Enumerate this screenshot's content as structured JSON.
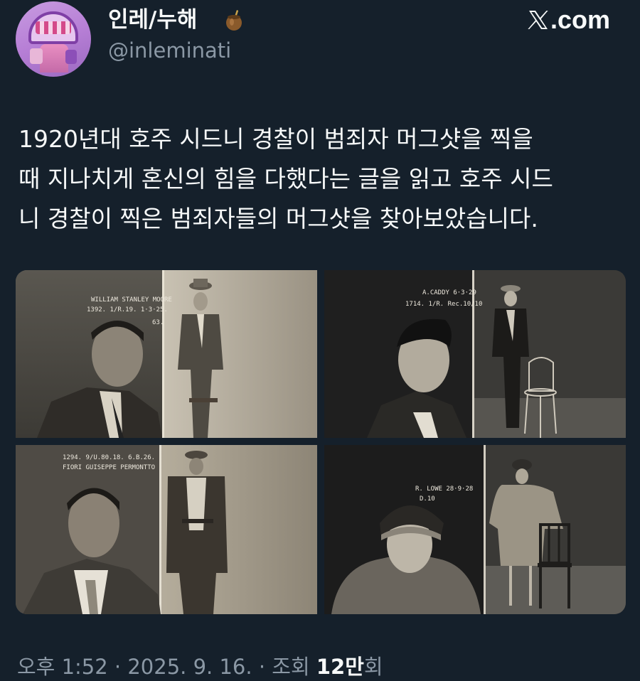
{
  "author": {
    "display_name": "인레/누해",
    "handle": "@inleminati",
    "name_emoji": "mate-cup-icon"
  },
  "brand": {
    "label": ".com",
    "icon": "x-logo-icon"
  },
  "tweet": {
    "lines": [
      "1920년대 호주 시드니 경찰이 범죄자 머그샷을 찍을",
      "때 지나치게 혼신의 힘을 다했다는 글을 읽고 호주 시드",
      "니 경찰이 찍은 범죄자들의 머그샷을 찾아보았습니다."
    ]
  },
  "media": {
    "photos": [
      {
        "caption_line1": "WILLIAM STANLEY MOORE",
        "caption_line2": "1392. 1/R.19. 1·3·25.",
        "tag": "63."
      },
      {
        "caption_line1": "A.CADDY 6·3·29",
        "caption_line2": "1714. 1/R. Rec.10/10"
      },
      {
        "caption_line1": "1294. 9/U.80.18. 6.B.26.",
        "caption_line2": "FIORI GUISEPPE PERMONTTO"
      },
      {
        "caption_line1": "R. LOWE 28·9·28",
        "caption_line2": "D.10"
      }
    ]
  },
  "footer": {
    "time": "오후 1:52",
    "sep1": " · ",
    "date": "2025. 9. 16.",
    "sep2": " · ",
    "views_label": "조회 ",
    "views_count": "12만",
    "views_suffix": "회"
  },
  "colors": {
    "background": "#15202b",
    "primary_text": "#f7f9f9",
    "secondary_text": "#8b98a5"
  }
}
